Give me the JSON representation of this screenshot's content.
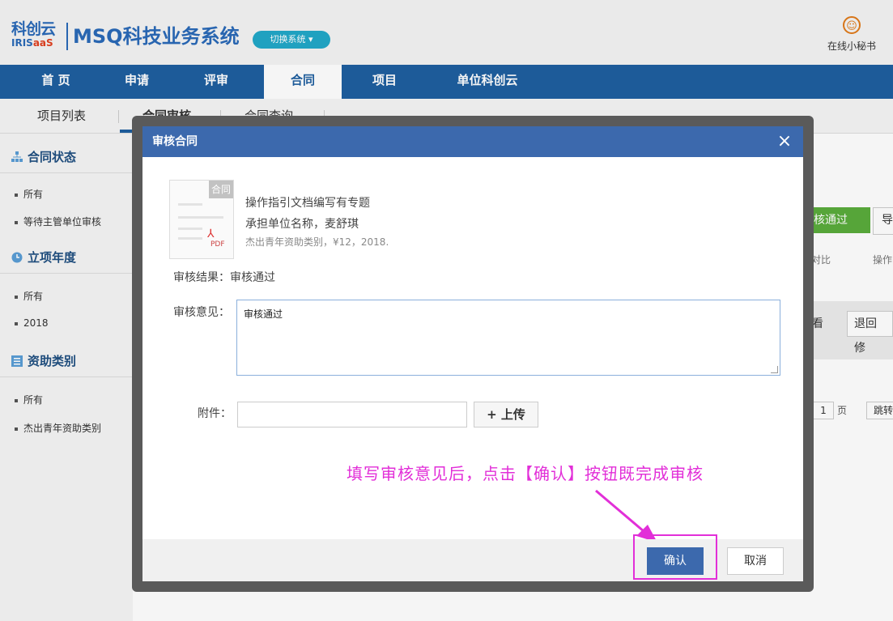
{
  "header": {
    "logo_top": "科创云",
    "logo_bottom_a": "IRIS",
    "logo_bottom_b": "aaS",
    "app_title": "MSQ科技业务系统",
    "switch_label": "切换系统 ▾",
    "assistant_label": "在线小秘书",
    "assistant_icon": "assistant-icon"
  },
  "main_nav": [
    {
      "label": "首 页"
    },
    {
      "label": "申请"
    },
    {
      "label": "评审"
    },
    {
      "label": "合同",
      "active": true
    },
    {
      "label": "项目"
    },
    {
      "label": "单位科创云"
    }
  ],
  "sub_nav": [
    {
      "label": "项目列表"
    },
    {
      "label": "合同审核",
      "active": true
    },
    {
      "label": "合同查询"
    }
  ],
  "sidebar": {
    "sections": [
      {
        "title": "合同状态",
        "icon": "org-chart-icon",
        "items": [
          "所有",
          "等待主管单位审核"
        ]
      },
      {
        "title": "立项年度",
        "icon": "clock-icon",
        "items": [
          "所有",
          "2018"
        ]
      },
      {
        "title": "资助类别",
        "icon": "list-icon",
        "items": [
          "所有",
          "杰出青年资助类别"
        ]
      }
    ]
  },
  "background": {
    "approve_button": "审核通过",
    "export_button": "导",
    "column_compare": "异对比",
    "column_ops": "操作",
    "view_button": "查看",
    "return_button": "退回修",
    "page_num": "1",
    "page_unit": "页",
    "jump_label": "跳转"
  },
  "dialog": {
    "title": "审核合同",
    "close_symbol": "×",
    "doc_tag": "合同",
    "doc_badge": "PDF",
    "doc_name": "操作指引文档编写有专题",
    "doc_org": "承担单位名称，麦舒琪",
    "doc_meta": "杰出青年资助类别，¥12，2018.",
    "result_label": "审核结果：",
    "result_value": "审核通过",
    "opinion_label": "审核意见：",
    "opinion_value": "审核通过",
    "attachment_label": "附件：",
    "attachment_value": "",
    "upload_label": "+ 上传",
    "confirm_label": "确认",
    "cancel_label": "取消"
  },
  "annotation": {
    "text": "填写审核意见后，点击【确认】按钮既完成审核",
    "color": "#e22fd8"
  },
  "colors": {
    "nav_bg": "#1f5fa0",
    "dialog_title_bg": "#3c69ad",
    "approve_green": "#5aac3c"
  }
}
